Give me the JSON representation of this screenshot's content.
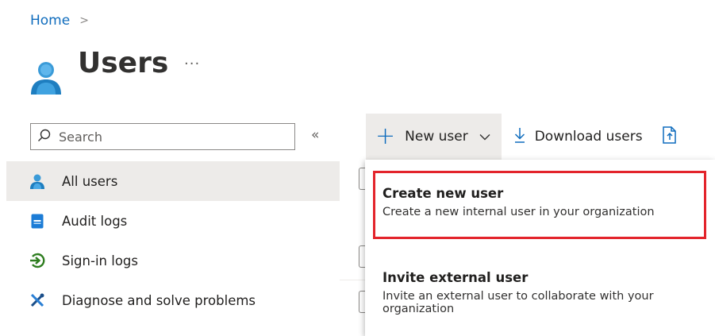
{
  "breadcrumb": {
    "home": "Home",
    "separator": ">"
  },
  "page": {
    "title": "Users",
    "more": "···",
    "icon": "user-icon"
  },
  "search": {
    "placeholder": "Search",
    "collapse": "«"
  },
  "sidebar": {
    "items": [
      {
        "label": "All users",
        "icon": "user-icon",
        "active": true
      },
      {
        "label": "Audit logs",
        "icon": "audit-log-icon",
        "active": false
      },
      {
        "label": "Sign-in logs",
        "icon": "sign-in-icon",
        "active": false
      },
      {
        "label": "Diagnose and solve problems",
        "icon": "tools-icon",
        "active": false
      }
    ]
  },
  "toolbar": {
    "new_user": "New user",
    "download_users": "Download users",
    "more_icon": "bulk-operations-icon"
  },
  "dropdown": {
    "items": [
      {
        "title": "Create new user",
        "description": "Create a new internal user in your organization",
        "highlighted": true
      },
      {
        "title": "Invite external user",
        "description": "Invite an external user to collaborate with your organization",
        "highlighted": false
      }
    ]
  },
  "colors": {
    "accent": "#0f6cbd",
    "highlight": "#e3242b",
    "selected_bg": "#edebe9"
  }
}
